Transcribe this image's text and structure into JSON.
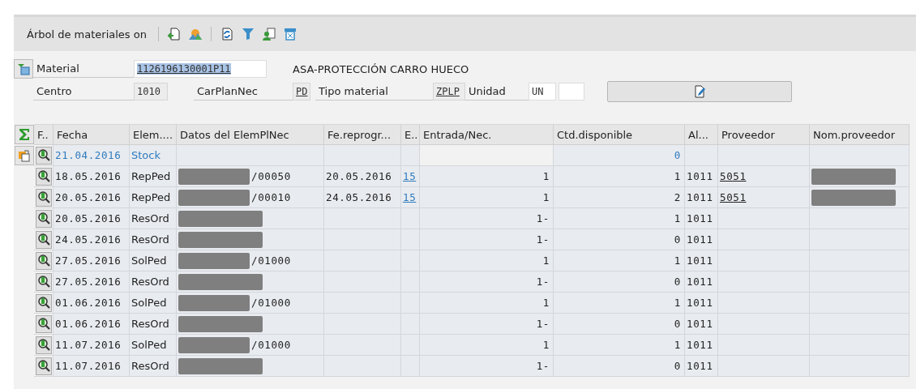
{
  "toolbar": {
    "title": "Árbol de materiales on"
  },
  "header": {
    "material_label": "Material",
    "material_value": "1126196130001P11",
    "material_highlighted": true,
    "material_text": "ASA-PROTECCIÓN CARRO HUECO",
    "centro_label": "Centro",
    "centro_value": "1010",
    "carplan_label": "CarPlanNec",
    "carplan_value": "PD",
    "tipo_label": "Tipo material",
    "tipo_value": "ZPLP",
    "unidad_label": "Unidad",
    "unidad_value": "UN"
  },
  "table": {
    "columns": [
      "F..",
      "Fecha",
      "Elem....",
      "Datos del ElemPlNec",
      "Fe.reprogr...",
      "E..",
      "Entrada/Nec.",
      "Ctd.disponible",
      "Al...",
      "Proveedor",
      "Nom.proveedor"
    ],
    "rows": [
      {
        "kind": "stock",
        "fecha": "21.04.2016",
        "elem": "Stock",
        "datos_redacted": false,
        "ctd": "0",
        "nom_redacted": false
      },
      {
        "kind": "normal",
        "fecha": "18.05.2016",
        "elem": "RepPed",
        "datos_redacted": true,
        "datos": "/00050",
        "reprog": "20.05.2016",
        "e": "15",
        "entrada": "1",
        "ctd": "1",
        "al": "1011",
        "proveedor": "5051",
        "nom_redacted": true
      },
      {
        "kind": "normal",
        "fecha": "20.05.2016",
        "elem": "RepPed",
        "datos_redacted": true,
        "datos": "/00010",
        "reprog": "24.05.2016",
        "e": "15",
        "entrada": "1",
        "ctd": "2",
        "al": "1011",
        "proveedor": "5051",
        "nom_redacted": true
      },
      {
        "kind": "normal",
        "fecha": "20.05.2016",
        "elem": "ResOrd",
        "datos_redacted": true,
        "entrada": "1-",
        "ctd": "1",
        "al": "1011",
        "nom_redacted": false
      },
      {
        "kind": "normal",
        "fecha": "24.05.2016",
        "elem": "ResOrd",
        "datos_redacted": true,
        "entrada": "1-",
        "ctd": "0",
        "al": "1011",
        "nom_redacted": false
      },
      {
        "kind": "normal",
        "fecha": "27.05.2016",
        "elem": "SolPed",
        "datos_redacted": true,
        "datos": "/01000",
        "entrada": "1",
        "ctd": "1",
        "al": "1011",
        "nom_redacted": false
      },
      {
        "kind": "normal",
        "fecha": "27.05.2016",
        "elem": "ResOrd",
        "datos_redacted": true,
        "entrada": "1-",
        "ctd": "0",
        "al": "1011",
        "nom_redacted": false
      },
      {
        "kind": "normal",
        "fecha": "01.06.2016",
        "elem": "SolPed",
        "datos_redacted": true,
        "datos": "/01000",
        "entrada": "1",
        "ctd": "1",
        "al": "1011",
        "nom_redacted": false
      },
      {
        "kind": "normal",
        "fecha": "01.06.2016",
        "elem": "ResOrd",
        "datos_redacted": true,
        "entrada": "1-",
        "ctd": "0",
        "al": "1011",
        "nom_redacted": false
      },
      {
        "kind": "normal",
        "fecha": "11.07.2016",
        "elem": "SolPed",
        "datos_redacted": true,
        "datos": "/01000",
        "entrada": "1",
        "ctd": "1",
        "al": "1011",
        "nom_redacted": false
      },
      {
        "kind": "normal",
        "fecha": "11.07.2016",
        "elem": "ResOrd",
        "datos_redacted": true,
        "entrada": "1-",
        "ctd": "0",
        "al": "1011",
        "nom_redacted": false
      }
    ]
  }
}
